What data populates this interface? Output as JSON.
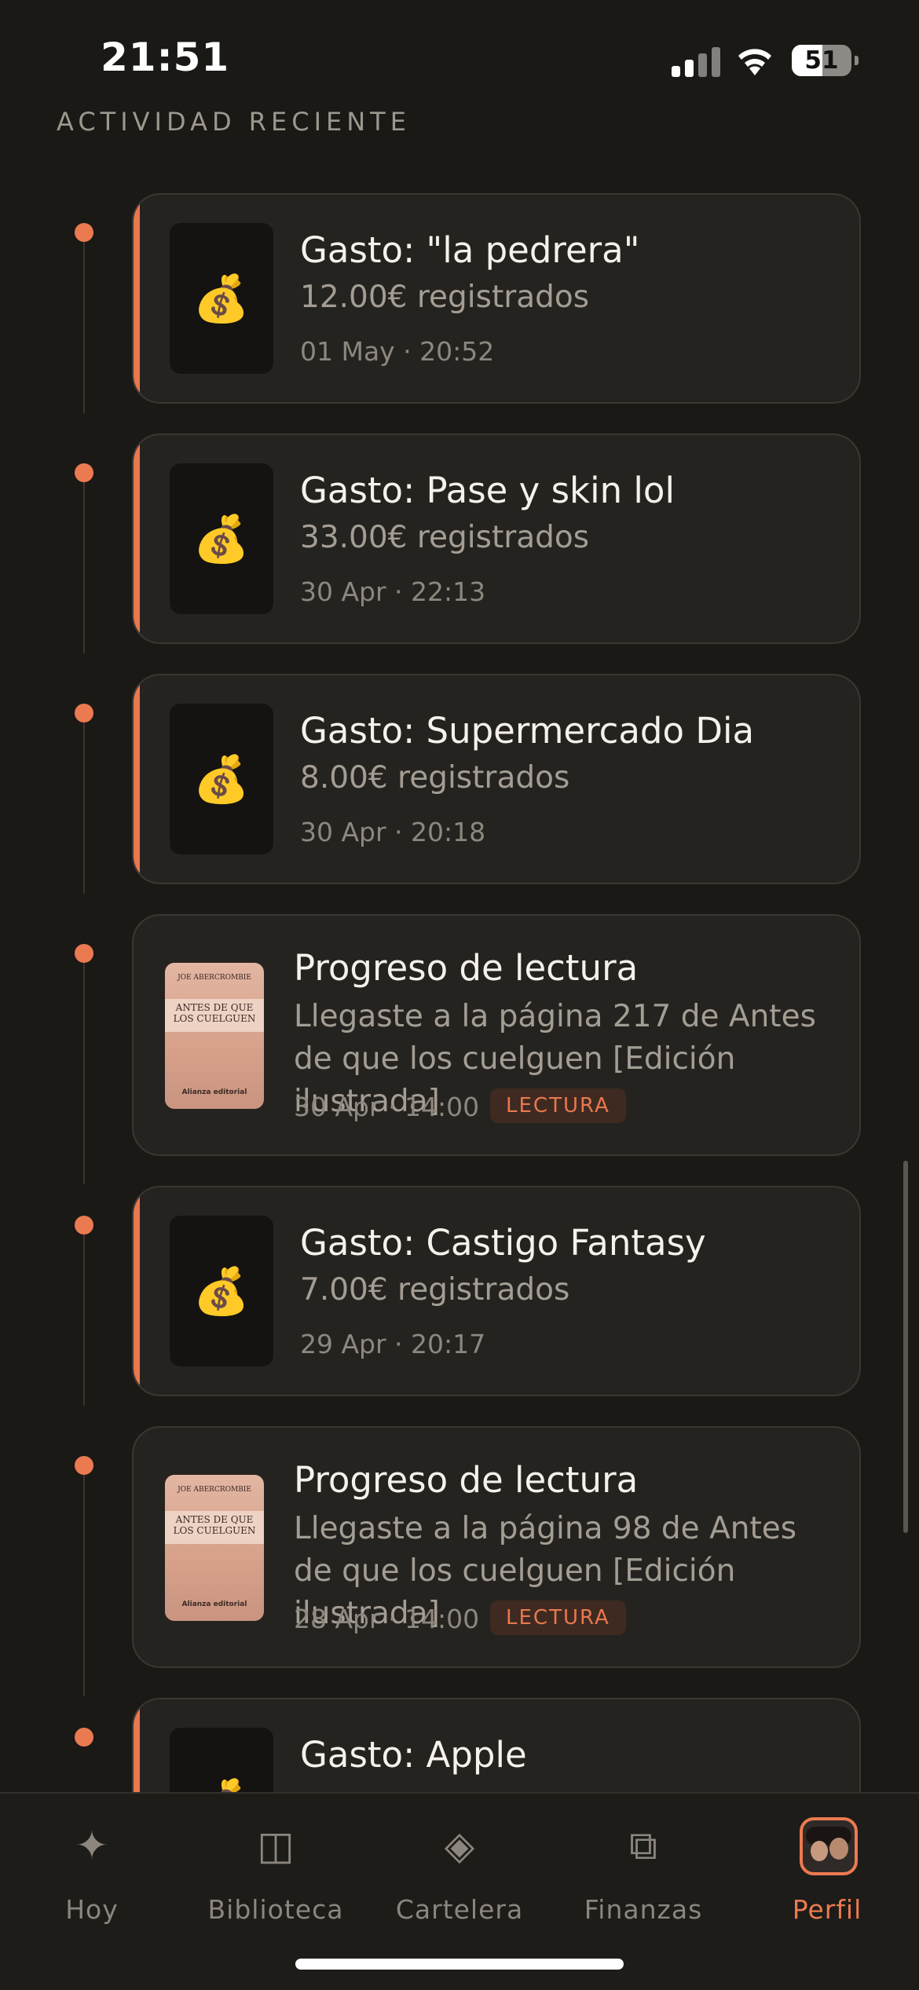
{
  "status_bar": {
    "time": "21:51",
    "battery": "51"
  },
  "section_title": "ACTIVIDAD RECIENTE",
  "activity": [
    {
      "kind": "expense",
      "icon": "money-bag-icon",
      "emoji": "💰",
      "title": "Gasto: \"la pedrera\"",
      "subtitle": "12.00€ registrados",
      "time": "01 May · 20:52"
    },
    {
      "kind": "expense",
      "icon": "money-bag-icon",
      "emoji": "💰",
      "title": "Gasto: Pase y skin lol",
      "subtitle": "33.00€ registrados",
      "time": "30 Apr · 22:13"
    },
    {
      "kind": "expense",
      "icon": "money-bag-icon",
      "emoji": "💰",
      "title": "Gasto: Supermercado Dia",
      "subtitle": "8.00€ registrados",
      "time": "30 Apr · 20:18"
    },
    {
      "kind": "reading",
      "title": "Progreso de lectura",
      "description": "Llegaste a la página 217 de Antes de que los cuelguen [Edición ilustrada]",
      "time": "30 Apr · 14:00",
      "tag": "LECTURA",
      "cover": {
        "author": "JOE ABERCROMBIE",
        "title": "ANTES DE QUE LOS CUELGUEN",
        "publisher": "Alianza editorial"
      }
    },
    {
      "kind": "expense",
      "icon": "money-bag-icon",
      "emoji": "💰",
      "title": "Gasto: Castigo Fantasy",
      "subtitle": "7.00€ registrados",
      "time": "29 Apr · 20:17"
    },
    {
      "kind": "reading",
      "title": "Progreso de lectura",
      "description": "Llegaste a la página 98 de Antes de que los cuelguen [Edición ilustrada]",
      "time": "28 Apr · 14:00",
      "tag": "LECTURA",
      "cover": {
        "author": "JOE ABERCROMBIE",
        "title": "ANTES DE QUE LOS CUELGUEN",
        "publisher": "Alianza editorial"
      }
    },
    {
      "kind": "expense",
      "icon": "money-bag-icon",
      "emoji": "💰",
      "title": "Gasto: Apple",
      "subtitle": "",
      "time": ""
    }
  ],
  "tab_bar": {
    "tabs": [
      {
        "label": "Hoy",
        "icon": "sparkle-icon",
        "glyph": "✦"
      },
      {
        "label": "Biblioteca",
        "icon": "book-icon",
        "glyph": "◫"
      },
      {
        "label": "Cartelera",
        "icon": "diamond-icon",
        "glyph": "◈"
      },
      {
        "label": "Finanzas",
        "icon": "squares-icon",
        "glyph": "⧉"
      },
      {
        "label": "Perfil",
        "icon": "avatar"
      }
    ],
    "active": "Perfil"
  },
  "colors": {
    "accent": "#ec7a50",
    "background": "#1a1916",
    "card": "#252320"
  }
}
